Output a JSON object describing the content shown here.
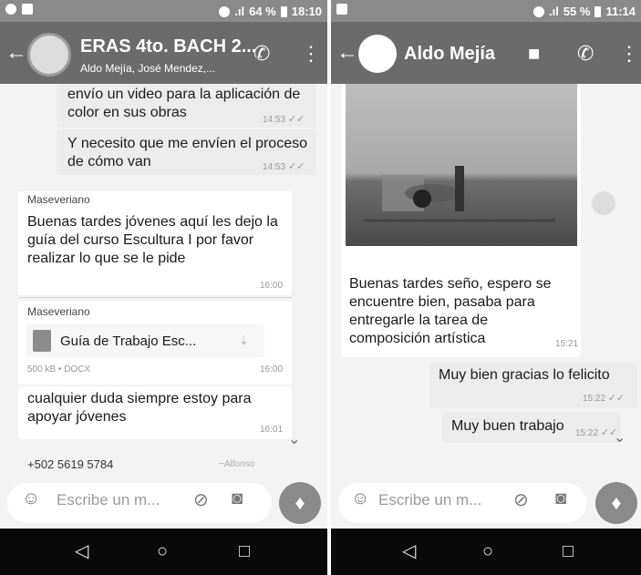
{
  "left": {
    "status": {
      "battery": "64 %",
      "time": "18:10"
    },
    "header": {
      "title": "ERAS 4to. BACH 2...",
      "subtitle": "Aldo Mejía, José Mendez,...",
      "back_icon": "arrow-left-icon",
      "call_icon": "add-call-icon",
      "menu_icon": "more-vert-icon"
    },
    "messages": [
      {
        "text": "envío un video para la aplicación de color en sus obras",
        "time": "14:53",
        "ticks": "✓✓"
      },
      {
        "text": "Y necesito que me envíen el proceso de cómo van",
        "time": "14:53",
        "ticks": "✓✓"
      },
      {
        "sender": "Maseveriano",
        "text": "Buenas tardes jóvenes aquí les dejo la guía del curso Escultura I por favor realizar lo que se le pide",
        "time": "16:00"
      },
      {
        "sender": "Maseveriano",
        "doc_name": "Guía de Trabajo Esc...",
        "doc_meta": "500 kB • DOCX",
        "time": "16:00"
      },
      {
        "text": "cualquier duda siempre estoy para apoyar jóvenes",
        "time": "16:01"
      }
    ],
    "last_sender": "+502 5619 5784",
    "last_sender_name": "~Alfonso",
    "input": {
      "placeholder": "Escribe un m..."
    }
  },
  "right": {
    "status": {
      "battery": "55 %",
      "time": "11:14"
    },
    "header": {
      "title": "Aldo Mejía",
      "back_icon": "arrow-left-icon",
      "video_icon": "videocam-icon",
      "call_icon": "call-icon",
      "menu_icon": "more-vert-icon"
    },
    "messages": [
      {
        "text": "Buenas tardes seño, espero se encuentre bien, pasaba para entregarle la tarea de composición artística",
        "time": "15:21"
      },
      {
        "text": "Muy bien gracias lo felicito",
        "time": "15:22",
        "ticks": "✓✓"
      },
      {
        "text": "Muy buen trabajo",
        "time": "15:22",
        "ticks": "✓✓"
      }
    ],
    "input": {
      "placeholder": "Escribe un m..."
    }
  },
  "nav": {
    "back": "◁",
    "home": "○",
    "recents": "□"
  }
}
